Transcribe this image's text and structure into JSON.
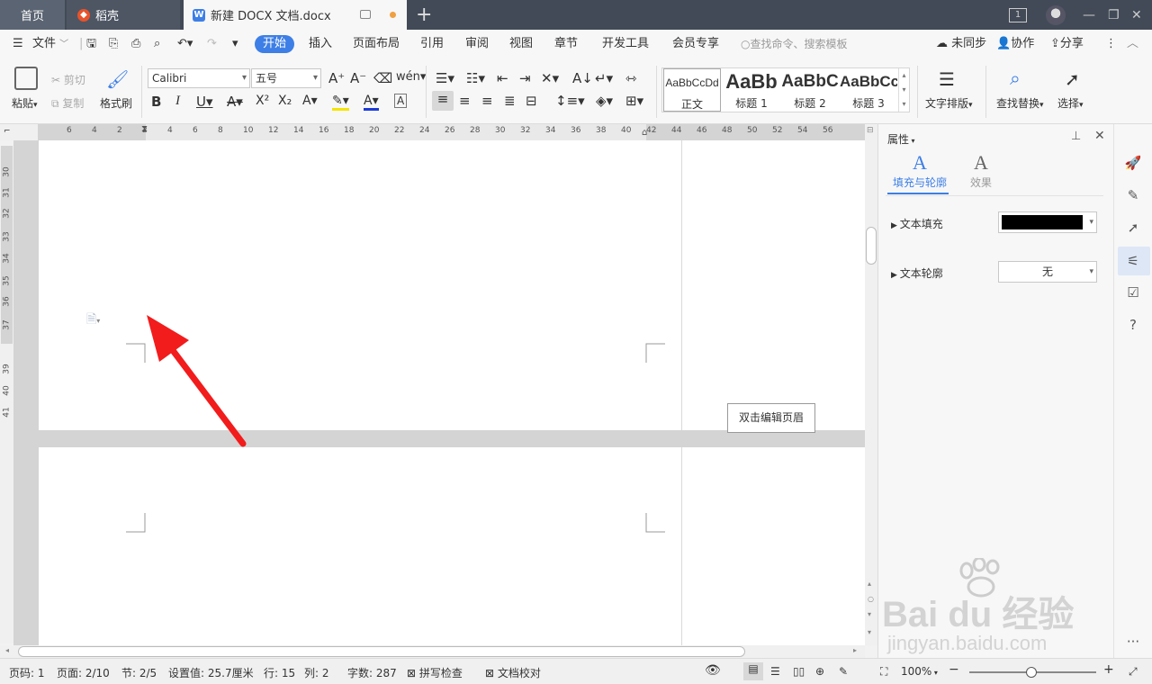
{
  "tabs": {
    "home": "首页",
    "daoke": "稻壳",
    "doc": "新建 DOCX 文档.docx",
    "add": "+"
  },
  "window": {
    "workspace_count": "1",
    "minimize": "—",
    "restore": "❐",
    "close": "✕"
  },
  "menu": {
    "file": "文件",
    "items": [
      "开始",
      "插入",
      "页面布局",
      "引用",
      "审阅",
      "视图",
      "章节",
      "开发工具",
      "会员专享"
    ],
    "search_placeholder": "查找命令、搜索模板",
    "sync": "未同步",
    "collab": "协作",
    "share": "分享",
    "more": "⋮"
  },
  "ribbon": {
    "paste": "粘贴",
    "cut": "剪切",
    "copy": "复制",
    "format_painter": "格式刷",
    "font_name": "Calibri",
    "font_size": "五号",
    "styles": [
      {
        "preview": "AaBbCcDd",
        "label": "正文"
      },
      {
        "preview": "AaBb",
        "label": "标题 1"
      },
      {
        "preview": "AaBbC",
        "label": "标题 2"
      },
      {
        "preview": "AaBbCc",
        "label": "标题 3"
      }
    ],
    "text_layout": "文字排版",
    "find_replace": "查找替换",
    "select": "选择"
  },
  "ruler": {
    "h_ticks": [
      "6",
      "4",
      "2",
      "2",
      "4",
      "6",
      "8",
      "10",
      "12",
      "14",
      "16",
      "18",
      "20",
      "22",
      "24",
      "26",
      "28",
      "30",
      "32",
      "34",
      "36",
      "38",
      "40",
      "42",
      "44",
      "46",
      "48",
      "50",
      "52",
      "54",
      "56"
    ],
    "v_ticks": [
      "30",
      "31",
      "32",
      "33",
      "34",
      "35",
      "36",
      "37",
      "39",
      "40",
      "41"
    ]
  },
  "document": {
    "header_edit_button": "双击编辑页眉"
  },
  "panel": {
    "title": "属性",
    "tab_fill": "填充与轮廓",
    "tab_effect": "效果",
    "text_fill": "文本填充",
    "text_outline": "文本轮廓",
    "outline_value": "无",
    "fill_color": "#000000"
  },
  "status": {
    "page_num": "页码: 1",
    "pages": "页面: 2/10",
    "section": "节: 2/5",
    "setting": "设置值: 25.7厘米",
    "line": "行: 15",
    "col": "列: 2",
    "words": "字数: 287",
    "spell_check": "拼写检查",
    "doc_proof": "文档校对",
    "zoom": "100%"
  },
  "watermark": {
    "brand": "Bai du 经验",
    "url": "jingyan.baidu.com"
  },
  "colors": {
    "accent": "#3d7fe6",
    "tabbar": "#424a57",
    "arrow": "#f21c1c"
  }
}
